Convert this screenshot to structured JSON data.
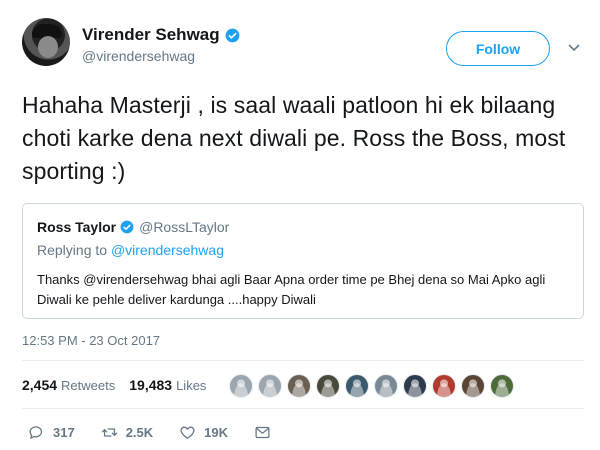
{
  "author": {
    "name": "Virender Sehwag",
    "handle": "@virendersehwag"
  },
  "follow_label": "Follow",
  "tweet_text": "Hahaha Masterji , is saal waali patloon hi ek bilaang choti karke dena next diwali pe. Ross the Boss, most sporting :)",
  "quoted": {
    "name": "Ross Taylor",
    "handle": "@RossLTaylor",
    "replying_prefix": "Replying to",
    "replying_to": "@virendersehwag",
    "text": "Thanks @virendersehwag bhai agli Baar Apna order time pe Bhej dena so Mai Apko agli Diwali ke pehle deliver  kardunga ....happy Diwali"
  },
  "timestamp": "12:53 PM - 23 Oct 2017",
  "stats": {
    "retweets_count": "2,454",
    "retweets_label": "Retweets",
    "likes_count": "19,483",
    "likes_label": "Likes"
  },
  "likers": [
    {
      "color": "#9aa5ae",
      "icon": "default-avatar-icon"
    },
    {
      "color": "#9aa5ae",
      "icon": "default-avatar-icon"
    },
    {
      "color": "#6b5e52",
      "icon": "user-avatar-icon"
    },
    {
      "color": "#4a4a3c",
      "icon": "user-avatar-icon"
    },
    {
      "color": "#3c5a6e",
      "icon": "user-avatar-icon"
    },
    {
      "color": "#7a8a94",
      "icon": "user-avatar-icon"
    },
    {
      "color": "#2e3b4e",
      "icon": "user-avatar-icon"
    },
    {
      "color": "#b03a2e",
      "icon": "user-avatar-icon"
    },
    {
      "color": "#5b4636",
      "icon": "user-avatar-icon"
    },
    {
      "color": "#4d6b3a",
      "icon": "user-avatar-icon"
    }
  ],
  "actions": {
    "reply_count": "317",
    "retweet_count": "2.5K",
    "like_count": "19K"
  },
  "colors": {
    "accent": "#1da1f2",
    "muted": "#657786",
    "border": "#ccd6dd"
  }
}
